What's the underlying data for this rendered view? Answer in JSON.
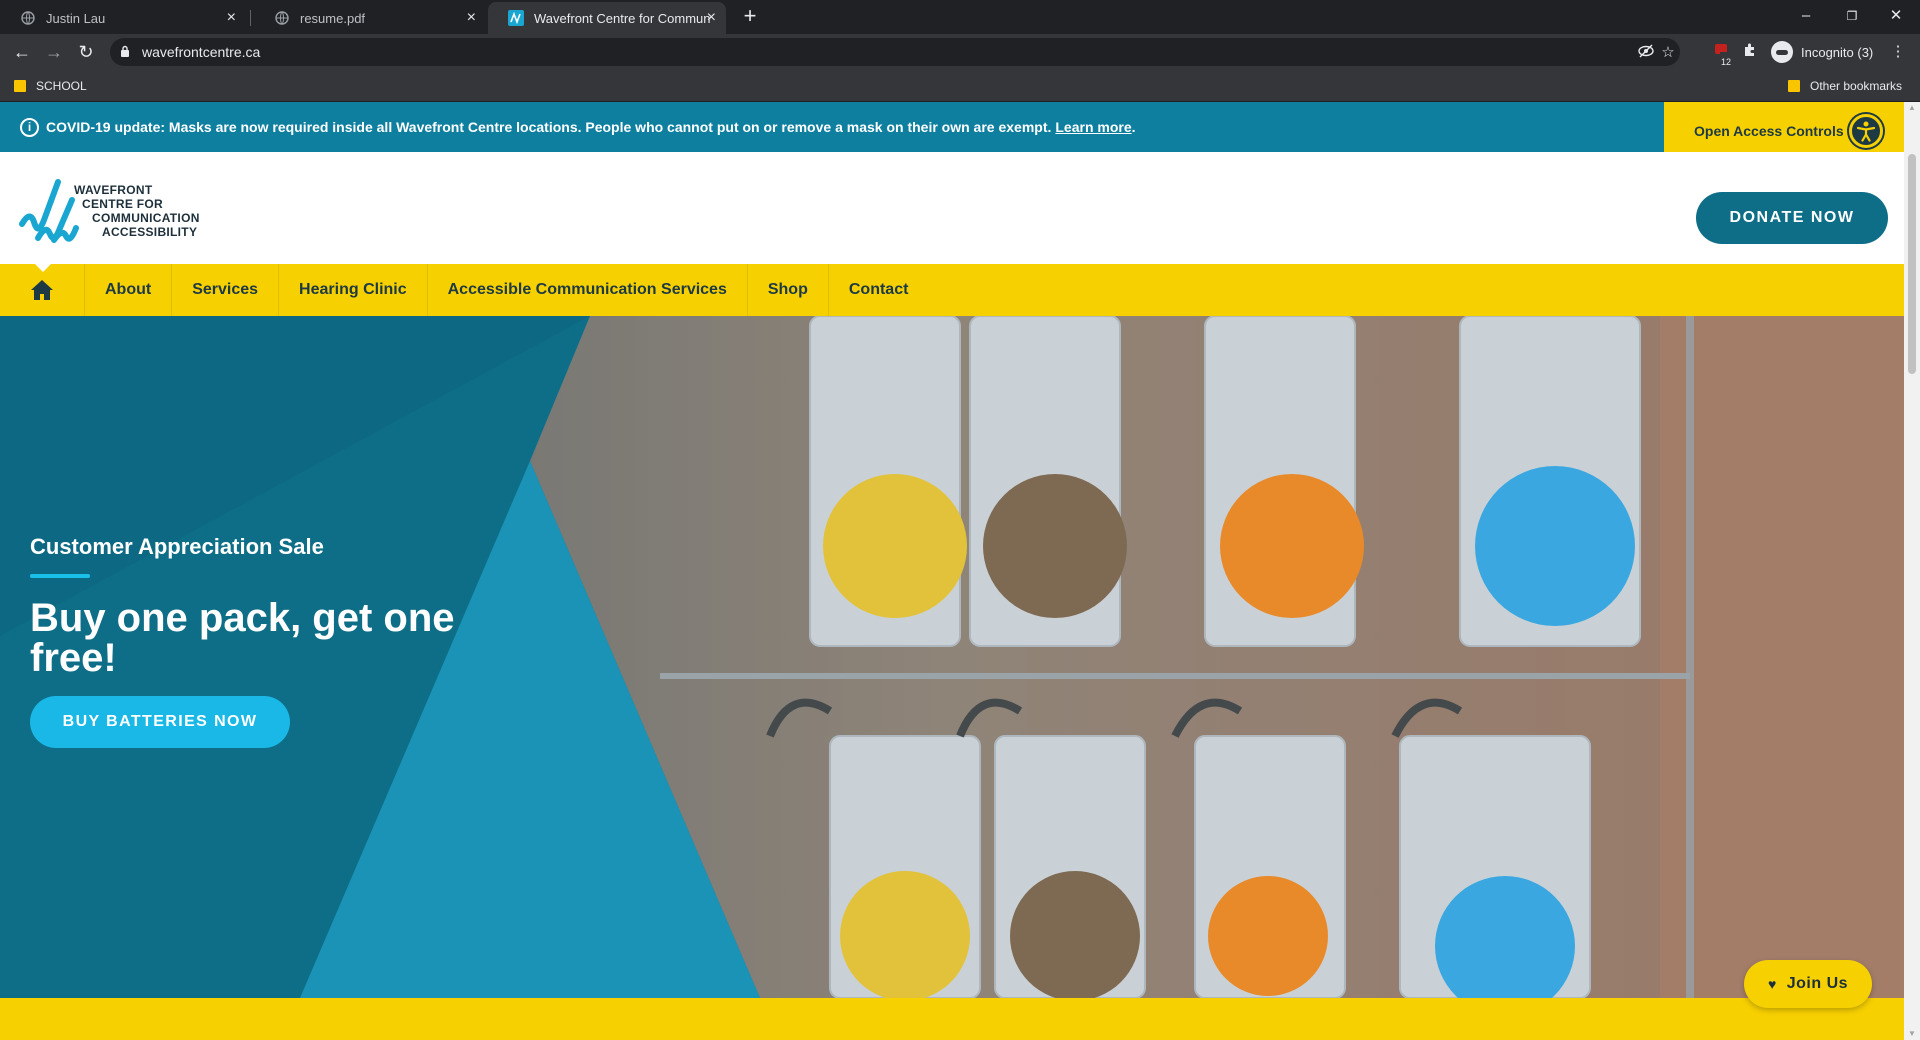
{
  "browser": {
    "tabs": [
      {
        "title": "Justin Lau",
        "active": false
      },
      {
        "title": "resume.pdf",
        "active": false
      },
      {
        "title": "Wavefront Centre for Communica",
        "active": true
      }
    ],
    "new_tab": "+",
    "window_controls": {
      "minimize": "–",
      "restore": "❐",
      "close": "✕"
    },
    "url": "wavefrontcentre.ca",
    "profile_label": "Incognito (3)",
    "extension_badge": "12",
    "bookmarks": [
      {
        "label": "SCHOOL"
      }
    ],
    "other_bookmarks": "Other bookmarks"
  },
  "alert_bar": {
    "message": "COVID-19 update: Masks are now required inside all Wavefront Centre locations. People who cannot put on or remove a mask on their own are exempt.",
    "link": "Learn more",
    "trailing": ".",
    "info_icon": "i"
  },
  "accessibility": {
    "label": "Open Access Controls"
  },
  "logo": {
    "lines": [
      "WAVEFRONT",
      "CENTRE FOR",
      "COMMUNICATION",
      "ACCESSIBILITY"
    ]
  },
  "donate_label": "DONATE NOW",
  "nav": {
    "items": [
      "About",
      "Services",
      "Hearing Clinic",
      "Accessible Communication Services",
      "Shop",
      "Contact"
    ]
  },
  "hero": {
    "eyebrow": "Customer Appreciation Sale",
    "headline": "Buy one pack, get one free!",
    "cta": "BUY BATTERIES NOW"
  },
  "join_us": {
    "label": "Join Us",
    "icon": "♥"
  },
  "colors": {
    "brand_blue": "#0e6e88",
    "brand_yellow": "#f7d000",
    "cta_blue": "#19b8e6"
  }
}
